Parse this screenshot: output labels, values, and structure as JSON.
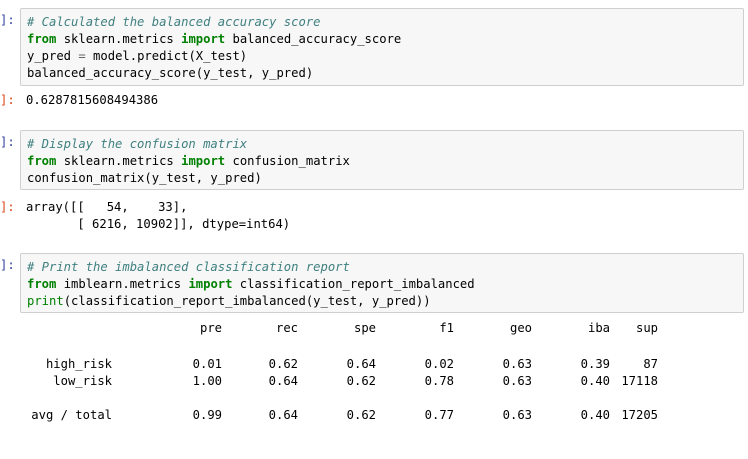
{
  "cells": [
    {
      "in_prompt": "]:",
      "code": [
        {
          "tokens": [
            {
              "t": "comment",
              "v": "# Calculated the balanced accuracy score"
            }
          ]
        },
        {
          "tokens": [
            {
              "t": "kw",
              "v": "from"
            },
            {
              "t": "plain",
              "v": " sklearn.metrics "
            },
            {
              "t": "kw",
              "v": "import"
            },
            {
              "t": "plain",
              "v": " balanced_accuracy_score"
            }
          ]
        },
        {
          "tokens": [
            {
              "t": "plain",
              "v": "y_pred "
            },
            {
              "t": "op",
              "v": "="
            },
            {
              "t": "plain",
              "v": " model.predict(X_test)"
            }
          ]
        },
        {
          "tokens": [
            {
              "t": "plain",
              "v": "balanced_accuracy_score(y_test, y_pred)"
            }
          ]
        }
      ],
      "out_prompt": "]:",
      "output": "0.6287815608494386"
    },
    {
      "in_prompt": "]:",
      "code": [
        {
          "tokens": [
            {
              "t": "comment",
              "v": "# Display the confusion matrix"
            }
          ]
        },
        {
          "tokens": [
            {
              "t": "kw",
              "v": "from"
            },
            {
              "t": "plain",
              "v": " sklearn.metrics "
            },
            {
              "t": "kw",
              "v": "import"
            },
            {
              "t": "plain",
              "v": " confusion_matrix"
            }
          ]
        },
        {
          "tokens": [
            {
              "t": "plain",
              "v": "confusion_matrix(y_test, y_pred)"
            }
          ]
        }
      ],
      "out_prompt": "]:",
      "output_line1": "array([[   54,    33],",
      "output_line2": "       [ 6216, 10902]], dtype=int64)"
    },
    {
      "in_prompt": "]:",
      "code": [
        {
          "tokens": [
            {
              "t": "comment",
              "v": "# Print the imbalanced classification report"
            }
          ]
        },
        {
          "tokens": [
            {
              "t": "kw",
              "v": "from"
            },
            {
              "t": "plain",
              "v": " imblearn.metrics "
            },
            {
              "t": "kw",
              "v": "import"
            },
            {
              "t": "plain",
              "v": " classification_report_imbalanced"
            }
          ]
        },
        {
          "tokens": [
            {
              "t": "builtin",
              "v": "print"
            },
            {
              "t": "plain",
              "v": "(classification_report_imbalanced(y_test, y_pred))"
            }
          ]
        }
      ]
    }
  ],
  "report": {
    "headers": [
      "pre",
      "rec",
      "spe",
      "f1",
      "geo",
      "iba",
      "sup"
    ],
    "rows": [
      {
        "label": "high_risk",
        "values": [
          "0.01",
          "0.62",
          "0.64",
          "0.02",
          "0.63",
          "0.39",
          "87"
        ]
      },
      {
        "label": "low_risk",
        "values": [
          "1.00",
          "0.64",
          "0.62",
          "0.78",
          "0.63",
          "0.40",
          "17118"
        ]
      },
      {
        "label": "avg / total",
        "values": [
          "0.99",
          "0.64",
          "0.62",
          "0.77",
          "0.63",
          "0.40",
          "17205"
        ]
      }
    ]
  }
}
